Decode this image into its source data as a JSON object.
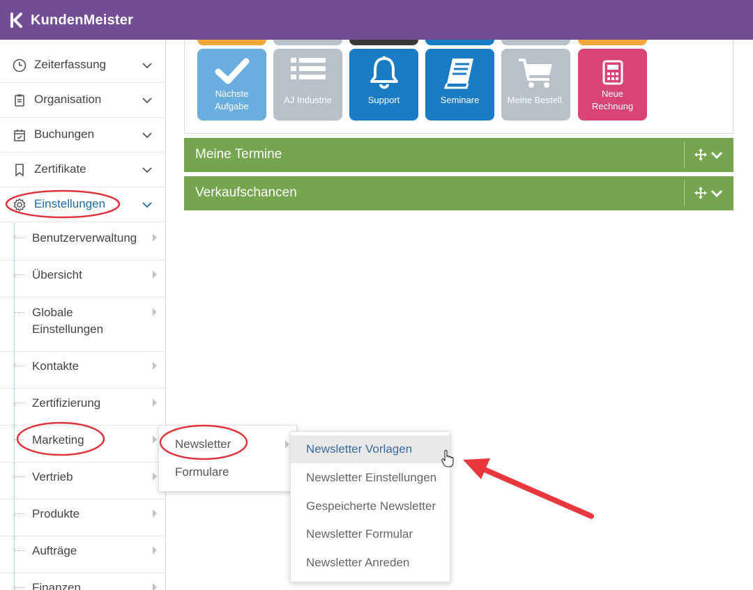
{
  "app": {
    "name": "KundenMeister"
  },
  "colors": {
    "header": "#734d93",
    "bar": "#76a550",
    "active": "#1d6aa8",
    "annotation": "#e0333b"
  },
  "sidebar": {
    "items": [
      {
        "label": "Zeiterfassung",
        "icon": "clock-icon"
      },
      {
        "label": "Organisation",
        "icon": "clipboard-icon"
      },
      {
        "label": "Buchungen",
        "icon": "calendar-check-icon"
      },
      {
        "label": "Zertifikate",
        "icon": "bookmark-icon"
      },
      {
        "label": "Einstellungen",
        "icon": "gear-icon"
      }
    ],
    "subitems": [
      {
        "label": "Benutzerverwaltung"
      },
      {
        "label": "Übersicht"
      },
      {
        "label": "Globale",
        "label2": "Einstellungen"
      },
      {
        "label": "Kontakte"
      },
      {
        "label": "Zertifizierung"
      },
      {
        "label": "Marketing"
      },
      {
        "label": "Vertrieb"
      },
      {
        "label": "Produkte"
      },
      {
        "label": "Aufträge"
      },
      {
        "label": "Finanzen"
      }
    ]
  },
  "tiles": [
    {
      "line1": "Nächste",
      "line2": "Aufgabe",
      "icon": "checkmark-icon",
      "color": "#6aaee0"
    },
    {
      "line1": "AJ Industrie",
      "icon": "list-icon",
      "color": "#b8c1ca"
    },
    {
      "line1": "Support",
      "icon": "bell-icon",
      "color": "#1b7cc6"
    },
    {
      "line1": "Seminare",
      "icon": "book-icon",
      "color": "#1b7cc6"
    },
    {
      "line1": "Meine Bestell.",
      "icon": "cart-icon",
      "color": "#b8c1ca"
    },
    {
      "line1": "Neue",
      "line2": "Rechnung",
      "icon": "calculator-icon",
      "color": "#d84475"
    }
  ],
  "panels": [
    {
      "title": "Meine Termine"
    },
    {
      "title": "Verkaufschancen"
    }
  ],
  "marketing_menu": {
    "items": [
      {
        "label": "Newsletter"
      },
      {
        "label": "Formulare"
      }
    ]
  },
  "newsletter_menu": {
    "items": [
      {
        "label": "Newsletter Vorlagen"
      },
      {
        "label": "Newsletter Einstellungen"
      },
      {
        "label": "Gespeicherte Newsletter"
      },
      {
        "label": "Newsletter Formular"
      },
      {
        "label": "Newsletter Anreden"
      }
    ]
  }
}
